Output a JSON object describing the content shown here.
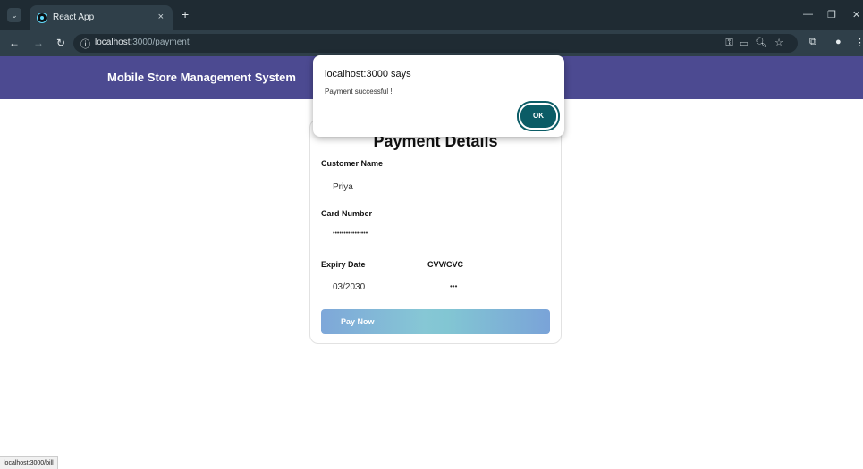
{
  "browser": {
    "tab_title": "React App",
    "tab_close": "×",
    "new_tab": "+",
    "url_host": "localhost",
    "url_path": ":3000/payment"
  },
  "app": {
    "title": "Mobile Store Management System"
  },
  "payment": {
    "heading": "Payment Details",
    "customer_name_label": "Customer Name",
    "customer_name_value": "Priya",
    "card_number_label": "Card Number",
    "card_number_value": "••••••••••••••••",
    "expiry_label": "Expiry Date",
    "expiry_value": "03/2030",
    "cvv_label": "CVV/CVC",
    "cvv_value": "•••",
    "pay_button": "Pay Now"
  },
  "dialog": {
    "title": "localhost:3000 says",
    "message": "Payment successful !",
    "ok_label": "OK"
  },
  "status_bar": "localhost:3000/bill",
  "colors": {
    "app_bar": "#4c4a91",
    "ok_button": "#0b5c66"
  }
}
